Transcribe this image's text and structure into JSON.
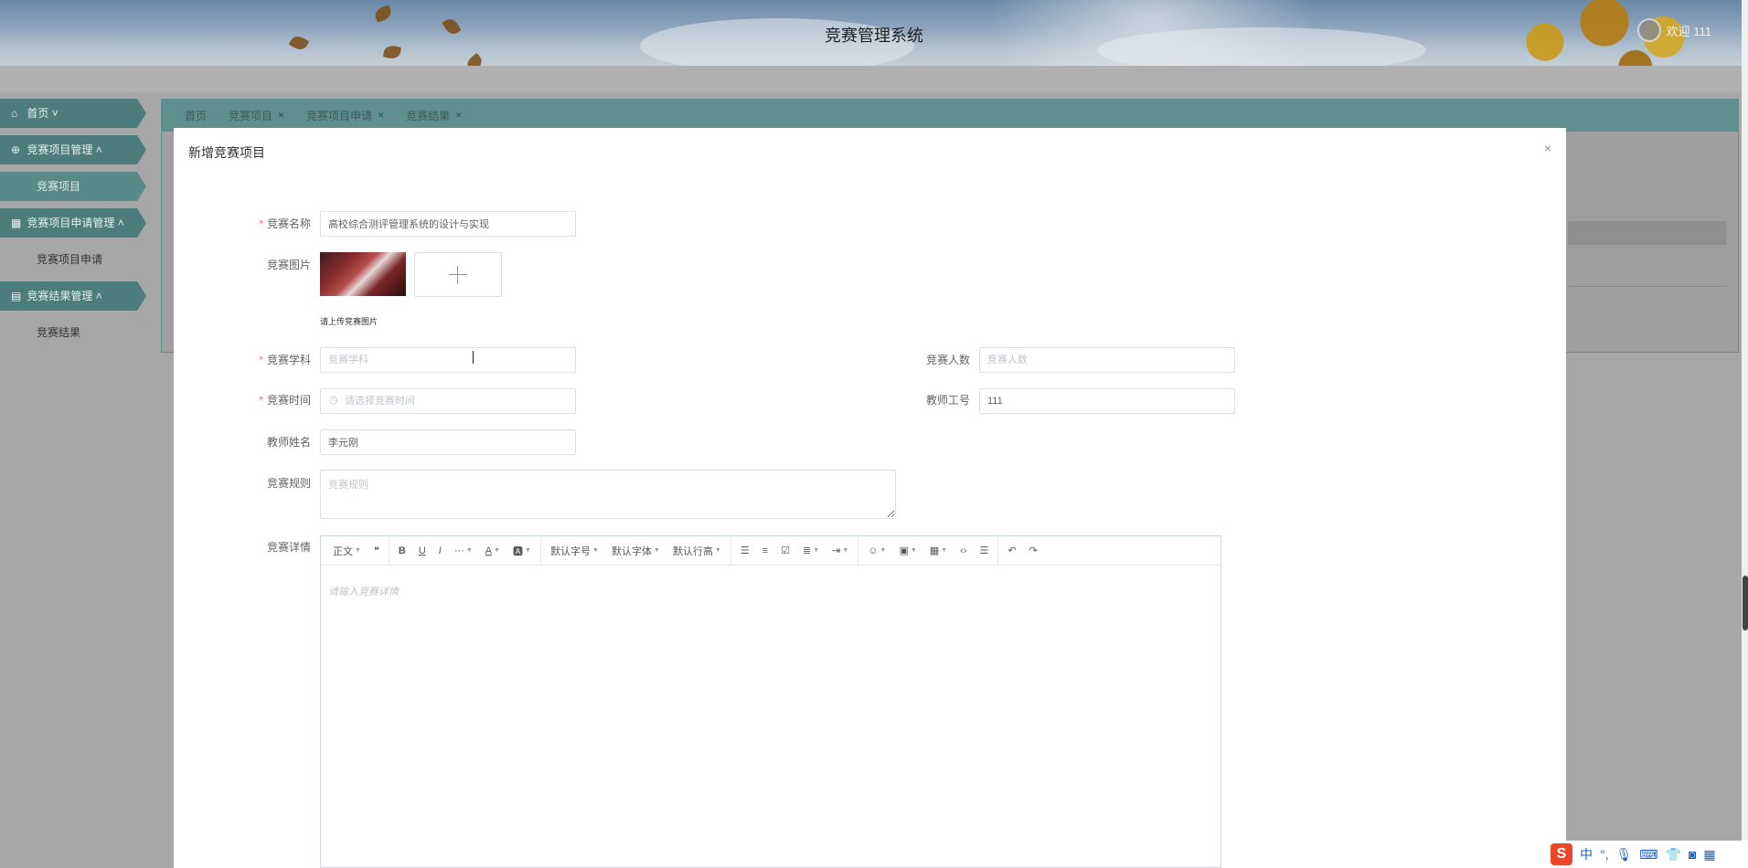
{
  "header": {
    "title": "竞赛管理系统",
    "user_label": "欢迎 111"
  },
  "sidebar": {
    "items": [
      {
        "label": "首页",
        "icon": "home-icon",
        "type": "parent"
      },
      {
        "label": "竞赛项目管理",
        "icon": "plus-circle-icon",
        "type": "parent"
      },
      {
        "label": "竞赛项目",
        "type": "child",
        "active": true
      },
      {
        "label": "竞赛项目申请管理",
        "icon": "grid-icon",
        "type": "parent"
      },
      {
        "label": "竞赛项目申请",
        "type": "child"
      },
      {
        "label": "竞赛结果管理",
        "icon": "book-icon",
        "type": "parent"
      },
      {
        "label": "竞赛结果",
        "type": "child"
      }
    ]
  },
  "tabs": [
    {
      "label": "首页"
    },
    {
      "label": "竞赛项目"
    },
    {
      "label": "竞赛项目申请"
    },
    {
      "label": "竞赛结果"
    }
  ],
  "dialog": {
    "title": "新增竞赛项目",
    "close": "×",
    "fields": {
      "name": {
        "label": "竞赛名称",
        "value": "高校综合测评管理系统的设计与实现"
      },
      "image": {
        "label": "竞赛图片",
        "hint": "请上传竞赛图片"
      },
      "subject": {
        "label": "竞赛学科",
        "placeholder": "竞赛学科"
      },
      "people": {
        "label": "竞赛人数",
        "placeholder": "竞赛人数"
      },
      "time": {
        "label": "竞赛时间",
        "placeholder": "请选择竞赛时间"
      },
      "teacher_id": {
        "label": "教师工号",
        "value": "111"
      },
      "teacher_name": {
        "label": "教师姓名",
        "value": "李元刚"
      },
      "rules": {
        "label": "竞赛规则",
        "placeholder": "竞赛规则"
      },
      "details": {
        "label": "竞赛详情",
        "placeholder": "请输入竞赛详情"
      }
    },
    "toolbar": {
      "paragraph": "正文",
      "font_size": "默认字号",
      "font_family": "默认字体",
      "line_height": "默认行高"
    }
  },
  "ime": {
    "logo": "S",
    "mode": "中"
  },
  "colors": {
    "sidebar": "#4c7c7c",
    "required": "#f56c6c",
    "border": "#dcdfe6"
  }
}
